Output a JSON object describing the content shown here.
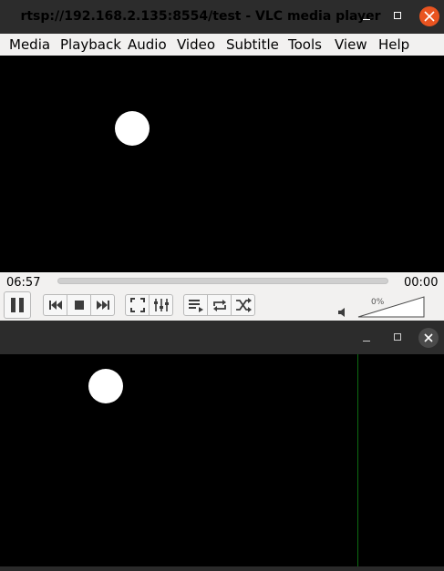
{
  "vlc_window": {
    "title": "rtsp://192.168.2.135:8554/test - VLC media player",
    "accent_close_color": "#e95420",
    "menu": [
      "Media",
      "Playback",
      "Audio",
      "Video",
      "Subtitle",
      "Tools",
      "View",
      "Help"
    ],
    "controls": {
      "time_elapsed": "06:57",
      "time_total": "00:00",
      "seek_progress": 0,
      "volume_label": "0%",
      "volume_level": 0,
      "buttons": [
        "pause",
        "previous",
        "stop",
        "next",
        "fullscreen",
        "extended-settings",
        "playlist",
        "loop",
        "random"
      ]
    },
    "video": {
      "background": "#000000",
      "object": "white-circle"
    }
  },
  "second_window": {
    "title": "",
    "video": {
      "background": "#000000",
      "object": "white-circle",
      "divider_color": "#0d6b12"
    }
  }
}
